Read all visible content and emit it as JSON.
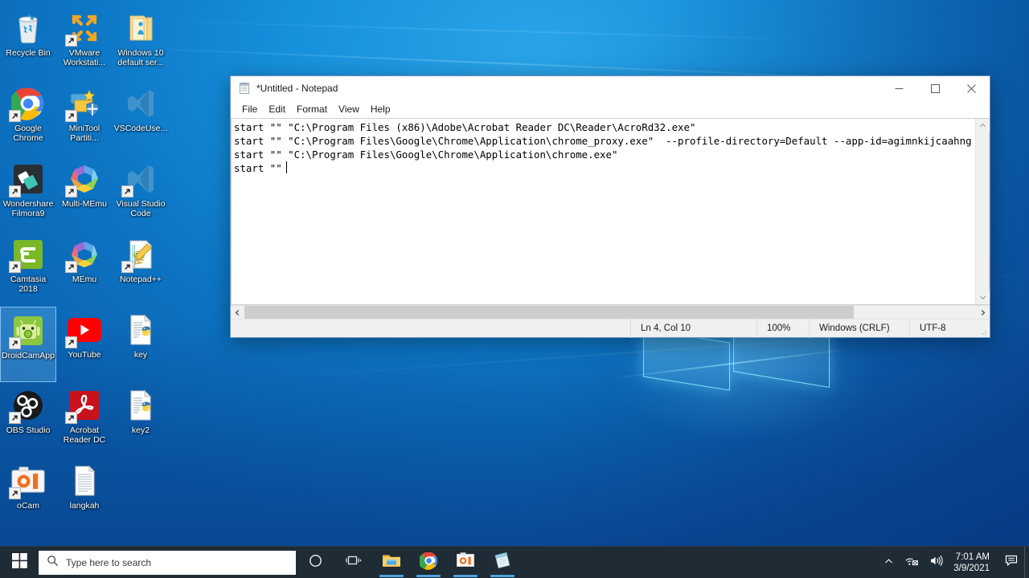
{
  "desktop": {
    "icons": [
      {
        "label": "Recycle Bin",
        "icon": "recycle-bin-icon",
        "shortcut": false,
        "selected": false
      },
      {
        "label": "VMware Workstati...",
        "icon": "vmware-icon",
        "shortcut": true,
        "selected": false
      },
      {
        "label": "Windows 10 default ser...",
        "icon": "folder-icon",
        "shortcut": false,
        "selected": false
      },
      {
        "label": "Google Chrome",
        "icon": "chrome-icon",
        "shortcut": true,
        "selected": false
      },
      {
        "label": "MiniTool Partiti...",
        "icon": "minitool-partition-icon",
        "shortcut": true,
        "selected": false
      },
      {
        "label": "VSCodeUse...",
        "icon": "vscode-icon",
        "shortcut": false,
        "selected": false
      },
      {
        "label": "Wondershare Filmora9",
        "icon": "filmora-icon",
        "shortcut": true,
        "selected": false
      },
      {
        "label": "Multi-MEmu",
        "icon": "multi-memu-icon",
        "shortcut": true,
        "selected": false
      },
      {
        "label": "Visual Studio Code",
        "icon": "vscode-icon",
        "shortcut": true,
        "selected": false
      },
      {
        "label": "Camtasia 2018",
        "icon": "camtasia-icon",
        "shortcut": true,
        "selected": false
      },
      {
        "label": "MEmu",
        "icon": "memu-icon",
        "shortcut": true,
        "selected": false
      },
      {
        "label": "Notepad++",
        "icon": "notepadpp-icon",
        "shortcut": true,
        "selected": false
      },
      {
        "label": "DroidCamApp",
        "icon": "droidcam-icon",
        "shortcut": true,
        "selected": true
      },
      {
        "label": "YouTube",
        "icon": "youtube-icon",
        "shortcut": true,
        "selected": false
      },
      {
        "label": "key",
        "icon": "python-file-icon",
        "shortcut": false,
        "selected": false
      },
      {
        "label": "OBS Studio",
        "icon": "obs-studio-icon",
        "shortcut": true,
        "selected": false
      },
      {
        "label": "Acrobat Reader DC",
        "icon": "acrobat-reader-icon",
        "shortcut": true,
        "selected": false
      },
      {
        "label": "key2",
        "icon": "python-file-icon",
        "shortcut": false,
        "selected": false
      },
      {
        "label": "oCam",
        "icon": "ocam-icon",
        "shortcut": true,
        "selected": false
      },
      {
        "label": "langkah",
        "icon": "text-file-icon",
        "shortcut": false,
        "selected": false
      }
    ]
  },
  "notepad": {
    "title": "*Untitled - Notepad",
    "icon": "notepad-icon",
    "menu": [
      {
        "label": "File"
      },
      {
        "label": "Edit"
      },
      {
        "label": "Format"
      },
      {
        "label": "View"
      },
      {
        "label": "Help"
      }
    ],
    "window_controls": {
      "minimize": "minimize-icon",
      "maximize": "maximize-icon",
      "close": "close-icon"
    },
    "content": {
      "lines": [
        "start \"\" \"C:\\Program Files (x86)\\Adobe\\Acrobat Reader DC\\Reader\\AcroRd32.exe\"",
        "start \"\" \"C:\\Program Files\\Google\\Chrome\\Application\\chrome_proxy.exe\"  --profile-directory=Default --app-id=agimnkijcaahng",
        "start \"\" \"C:\\Program Files\\Google\\Chrome\\Application\\chrome.exe\"",
        "start \"\""
      ]
    },
    "statusbar": {
      "position": "Ln 4, Col 10",
      "zoom": "100%",
      "line_ending": "Windows (CRLF)",
      "encoding": "UTF-8"
    },
    "scrollbars": {
      "vertical_up": "chevron-up-icon",
      "vertical_down": "chevron-down-icon",
      "horizontal_left": "chevron-left-icon",
      "horizontal_right": "chevron-right-icon"
    }
  },
  "taskbar": {
    "start": "windows-start-icon",
    "search": {
      "placeholder": "Type here to search",
      "icon": "search-icon"
    },
    "cortana": "cortana-icon",
    "task_view": "task-view-icon",
    "apps": [
      {
        "name": "file-explorer",
        "icon": "file-explorer-icon",
        "running": true
      },
      {
        "name": "google-chrome",
        "icon": "chrome-icon",
        "running": true
      },
      {
        "name": "ocam",
        "icon": "ocam-icon",
        "running": true
      },
      {
        "name": "notepad",
        "icon": "notepad-icon",
        "running": true
      }
    ],
    "tray": {
      "overflow": "chevron-up-icon",
      "network": "network-disconnected-icon",
      "volume": "volume-icon",
      "time": "7:01 AM",
      "date": "3/9/2021",
      "action_center": "action-center-icon"
    }
  },
  "colors": {
    "desktop_blue": "#0d77c6",
    "taskbar": "#1f2b35",
    "accent": "#0078d7",
    "window_bg": "#f0f0f0",
    "indicator": "#4ea3e0"
  }
}
